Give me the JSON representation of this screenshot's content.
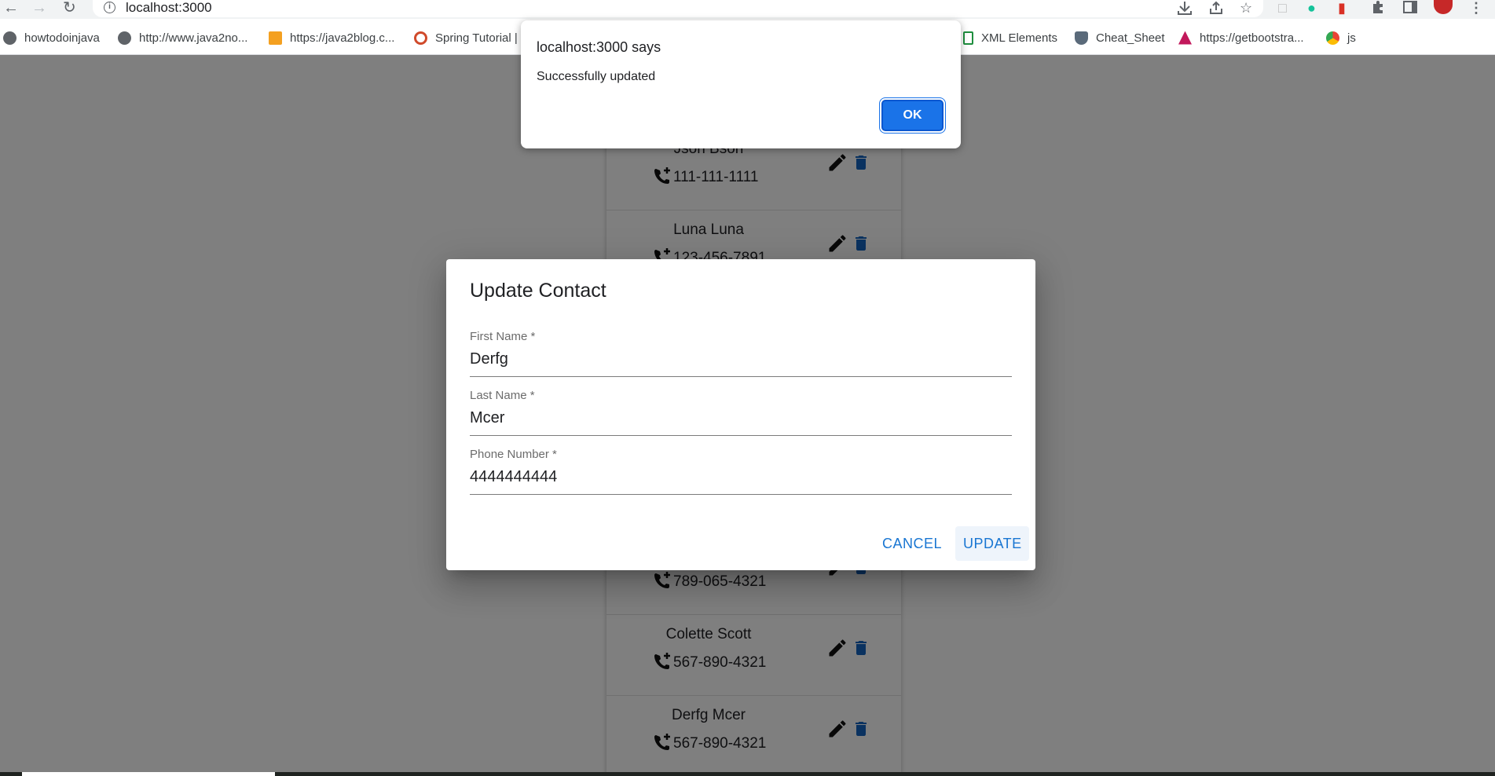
{
  "browser": {
    "url": "localhost:3000",
    "bookmarks": [
      {
        "label": "howtodoinjava",
        "icon": "globe-icon"
      },
      {
        "label": "http://www.java2no...",
        "icon": "globe-icon"
      },
      {
        "label": "https://java2blog.c...",
        "icon": "java2blog-icon"
      },
      {
        "label": "Spring Tutorial |",
        "icon": "spring-icon"
      },
      {
        "label": "XML Elements",
        "icon": "doc-icon"
      },
      {
        "label": "Cheat_Sheet",
        "icon": "shield-icon"
      },
      {
        "label": "https://getbootstra...",
        "icon": "bootstrap-icon"
      },
      {
        "label": "js",
        "icon": "chrome-icon"
      }
    ]
  },
  "contacts": [
    {
      "name": "Json Bson",
      "phone": "111-111-1111"
    },
    {
      "name": "Luna Luna",
      "phone": "123-456-7891"
    },
    {
      "name": "",
      "phone": "789-065-4321"
    },
    {
      "name": "Colette Scott",
      "phone": "567-890-4321"
    },
    {
      "name": "Derfg Mcer",
      "phone": "567-890-4321"
    }
  ],
  "dialog": {
    "title": "Update Contact",
    "first_name_label": "First Name *",
    "first_name_value": "Derfg",
    "last_name_label": "Last Name *",
    "last_name_value": "Mcer",
    "phone_label": "Phone Number *",
    "phone_value": "4444444444",
    "cancel_label": "CANCEL",
    "update_label": "UPDATE"
  },
  "alert": {
    "title": "localhost:3000 says",
    "message": "Successfully updated",
    "ok_label": "OK"
  },
  "colors": {
    "accent": "#1976d2",
    "delete": "#1565c0",
    "alert_button": "#1a73e8"
  }
}
